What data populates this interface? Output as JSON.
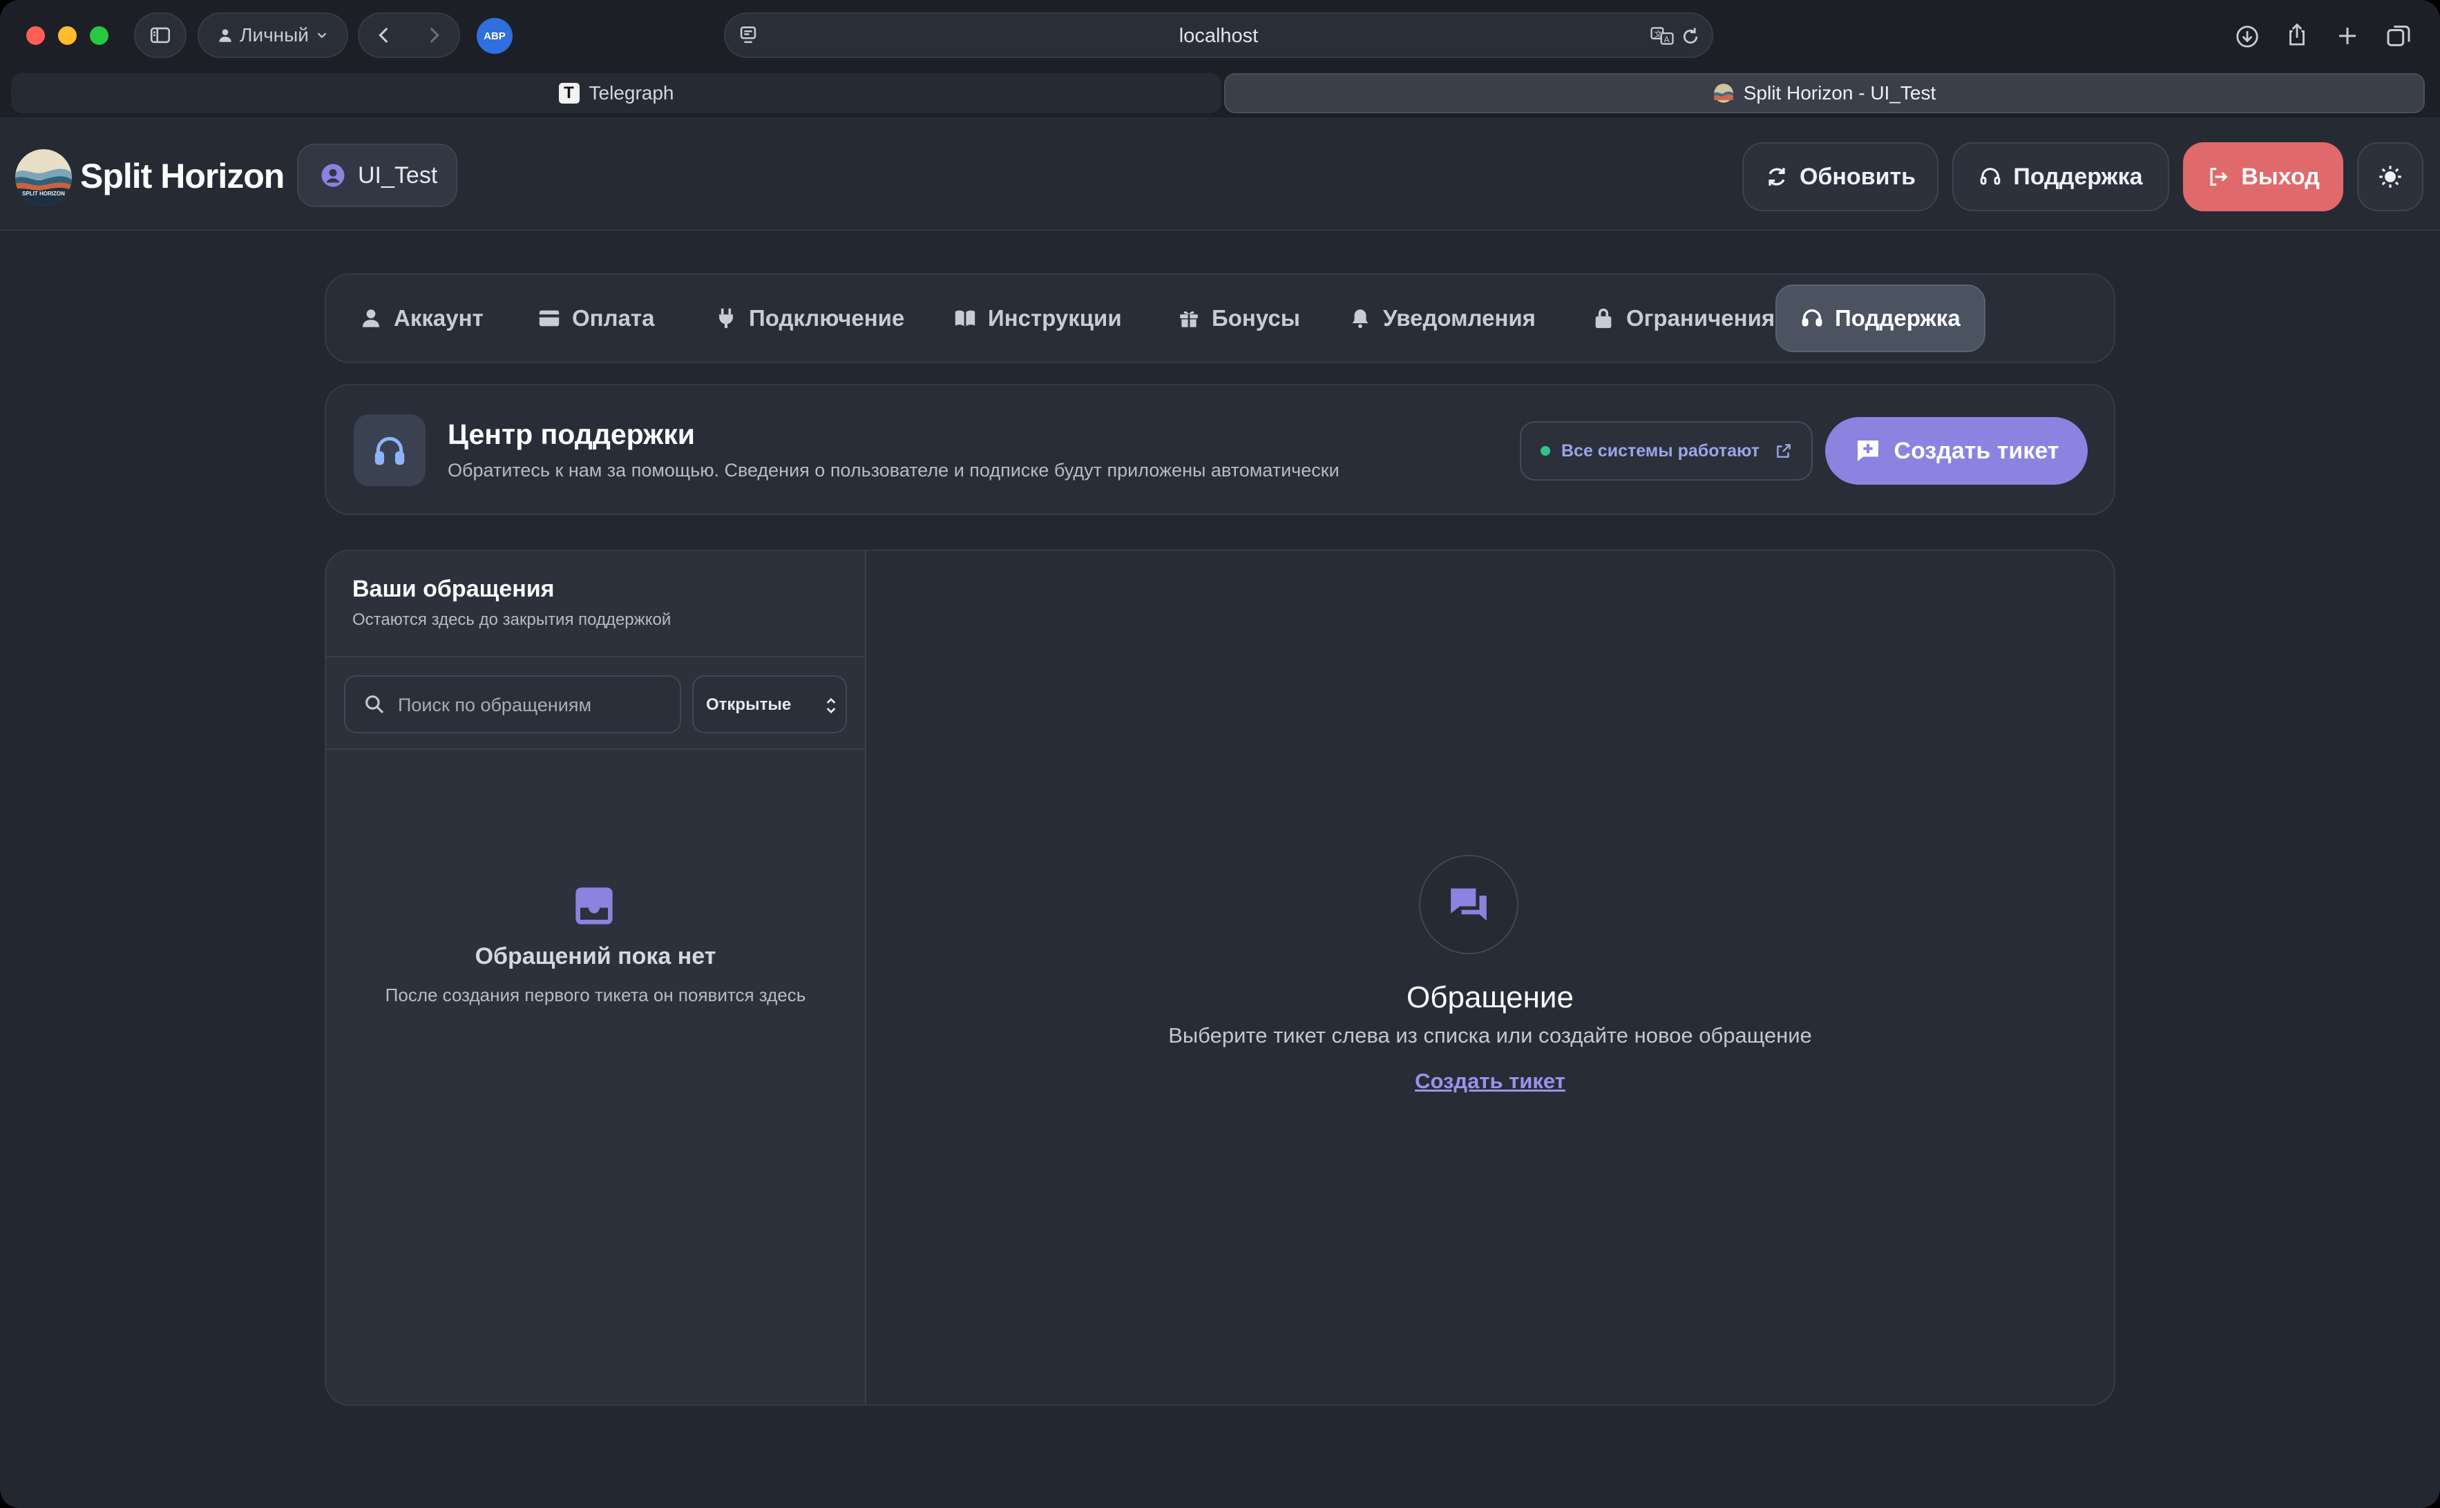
{
  "browser": {
    "profile_label": "Личный",
    "extension_label": "ABP",
    "url": "localhost",
    "tabs": [
      {
        "title": "Telegraph",
        "active": false,
        "icon": "telegraph-logo"
      },
      {
        "title": "Split Horizon - UI_Test",
        "active": true,
        "icon": "split-horizon-logo"
      }
    ]
  },
  "header": {
    "brand": "Split Horizon",
    "logo_caption": "SPLIT HORIZON",
    "user": "UI_Test",
    "refresh_label": "Обновить",
    "support_label": "Поддержка",
    "logout_label": "Выход",
    "theme_icon": "sun-icon"
  },
  "nav": {
    "items": [
      {
        "label": "Аккаунт",
        "icon": "user-icon"
      },
      {
        "label": "Оплата",
        "icon": "card-icon"
      },
      {
        "label": "Подключение",
        "icon": "plug-icon"
      },
      {
        "label": "Инструкции",
        "icon": "book-icon"
      },
      {
        "label": "Бонусы",
        "icon": "gift-icon"
      },
      {
        "label": "Уведомления",
        "icon": "bell-icon"
      },
      {
        "label": "Ограничения",
        "icon": "lock-icon"
      },
      {
        "label": "Поддержка",
        "icon": "headset-icon",
        "active": true
      }
    ]
  },
  "support": {
    "title": "Центр поддержки",
    "subtitle": "Обратитесь к нам за помощью. Сведения о пользователе и подписке будут приложены автоматически",
    "status": "Все системы работают",
    "create_button": "Создать тикет"
  },
  "tickets": {
    "title": "Ваши обращения",
    "subtitle": "Остаются здесь до закрытия поддержкой",
    "search_placeholder": "Поиск по обращениям",
    "filter_value": "Открытые",
    "empty_title": "Обращений пока нет",
    "empty_subtitle": "После создания первого тикета он появится здесь"
  },
  "detail": {
    "title": "Обращение",
    "subtitle": "Выберите тикет слева из списка или создайте новое обращение",
    "link": "Создать тикет"
  },
  "colors": {
    "accent": "#8a83e0",
    "logout": "#e0696b",
    "status_ok": "#35c28a",
    "background": "#232730"
  }
}
